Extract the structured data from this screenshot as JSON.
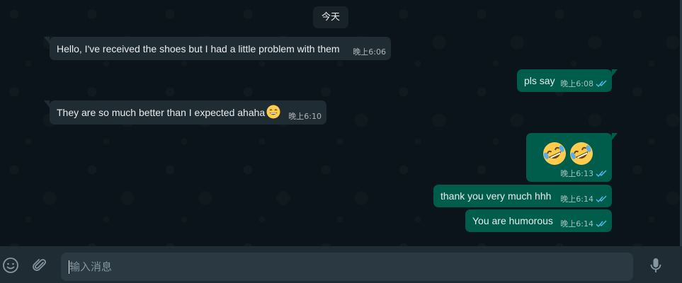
{
  "chat": {
    "date_chip": "今天",
    "messages": [
      {
        "dir": "in",
        "text": "Hello, I've received the shoes but I had a little problem with them",
        "time": "晚上6:06"
      },
      {
        "dir": "out",
        "text": "pls say",
        "time": "晚上6:08",
        "read": true
      },
      {
        "dir": "in",
        "text": "They are so much better than I expected ahaha",
        "emoji": "grinning-face-with-smiling-eyes",
        "time": "晚上6:10"
      },
      {
        "dir": "out",
        "emoji": [
          "rolling-on-floor-laughing",
          "rolling-on-floor-laughing"
        ],
        "time": "晚上6:13",
        "read": true
      },
      {
        "dir": "out",
        "text": "thank you very much hhh",
        "time": "晚上6:14",
        "read": true
      },
      {
        "dir": "out",
        "text": "You are humorous",
        "time": "晚上6:14",
        "read": true
      }
    ]
  },
  "composer": {
    "placeholder": "输入消息",
    "emoji_icon": "smiley-icon",
    "attach_icon": "paperclip-icon",
    "mic_icon": "microphone-icon"
  },
  "colors": {
    "background": "#0b141a",
    "incoming_bubble": "#202c33",
    "outgoing_bubble": "#005c4b",
    "read_ticks": "#53bdeb"
  }
}
